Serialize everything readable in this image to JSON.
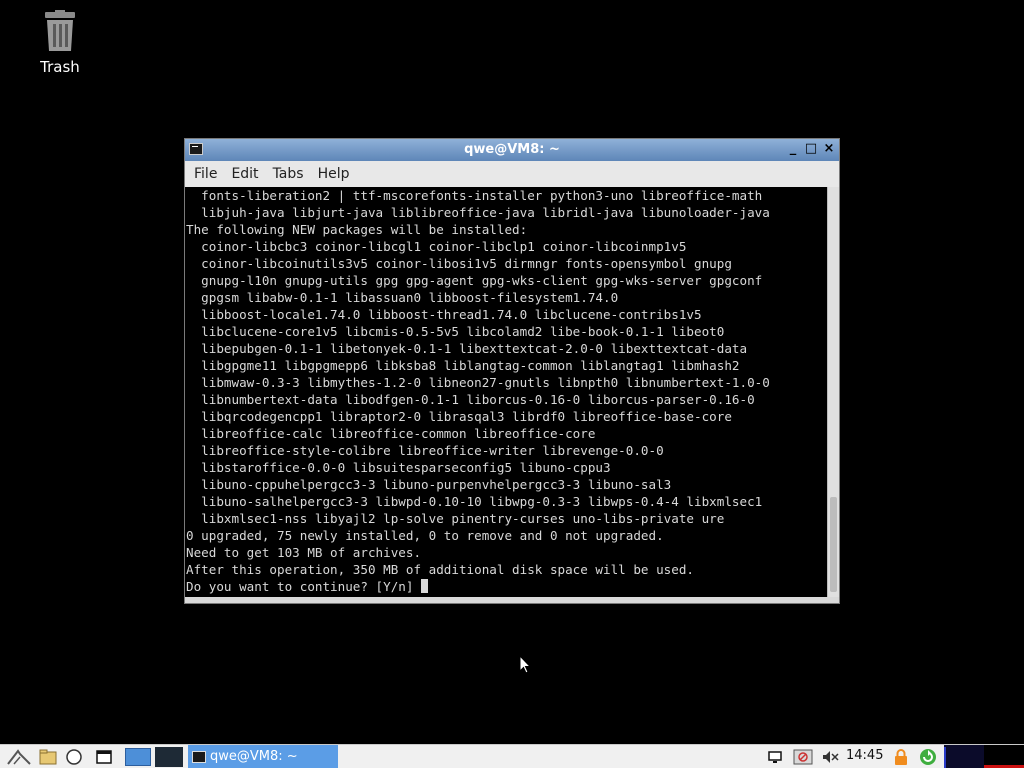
{
  "desktop": {
    "icons": [
      {
        "label": "Trash",
        "icon": "trash-icon"
      }
    ]
  },
  "window": {
    "title": "qwe@VM8: ~",
    "controls": {
      "minimize": "_",
      "maximize": "□",
      "close": "×"
    },
    "menu": [
      "File",
      "Edit",
      "Tabs",
      "Help"
    ]
  },
  "terminal": {
    "lines": [
      "  fonts-liberation2 | ttf-mscorefonts-installer python3-uno libreoffice-math",
      "  libjuh-java libjurt-java liblibreoffice-java libridl-java libunoloader-java",
      "The following NEW packages will be installed:",
      "  coinor-libcbc3 coinor-libcgl1 coinor-libclp1 coinor-libcoinmp1v5",
      "  coinor-libcoinutils3v5 coinor-libosi1v5 dirmngr fonts-opensymbol gnupg",
      "  gnupg-l10n gnupg-utils gpg gpg-agent gpg-wks-client gpg-wks-server gpgconf",
      "  gpgsm libabw-0.1-1 libassuan0 libboost-filesystem1.74.0",
      "  libboost-locale1.74.0 libboost-thread1.74.0 libclucene-contribs1v5",
      "  libclucene-core1v5 libcmis-0.5-5v5 libcolamd2 libe-book-0.1-1 libeot0",
      "  libepubgen-0.1-1 libetonyek-0.1-1 libexttextcat-2.0-0 libexttextcat-data",
      "  libgpgme11 libgpgmepp6 libksba8 liblangtag-common liblangtag1 libmhash2",
      "  libmwaw-0.3-3 libmythes-1.2-0 libneon27-gnutls libnpth0 libnumbertext-1.0-0",
      "  libnumbertext-data libodfgen-0.1-1 liborcus-0.16-0 liborcus-parser-0.16-0",
      "  libqrcodegencpp1 libraptor2-0 librasqal3 librdf0 libreoffice-base-core",
      "  libreoffice-calc libreoffice-common libreoffice-core",
      "  libreoffice-style-colibre libreoffice-writer librevenge-0.0-0",
      "  libstaroffice-0.0-0 libsuitesparseconfig5 libuno-cppu3",
      "  libuno-cppuhelpergcc3-3 libuno-purpenvhelpergcc3-3 libuno-sal3",
      "  libuno-salhelpergcc3-3 libwpd-0.10-10 libwpg-0.3-3 libwps-0.4-4 libxmlsec1",
      "  libxmlsec1-nss libyajl2 lp-solve pinentry-curses uno-libs-private ure",
      "0 upgraded, 75 newly installed, 0 to remove and 0 not upgraded.",
      "Need to get 103 MB of archives.",
      "After this operation, 350 MB of additional disk space will be used."
    ],
    "prompt": "Do you want to continue? [Y/n] "
  },
  "taskbar": {
    "task_label": "qwe@VM8: ~",
    "clock": "14:45",
    "launchers": [
      "start-menu-icon",
      "file-manager-icon",
      "web-browser-icon",
      "show-desktop-icon"
    ],
    "tray": [
      "screen-icon",
      "record-icon",
      "volume-muted-icon",
      "lock-icon",
      "update-icon",
      "cpu-graph-icon"
    ]
  }
}
